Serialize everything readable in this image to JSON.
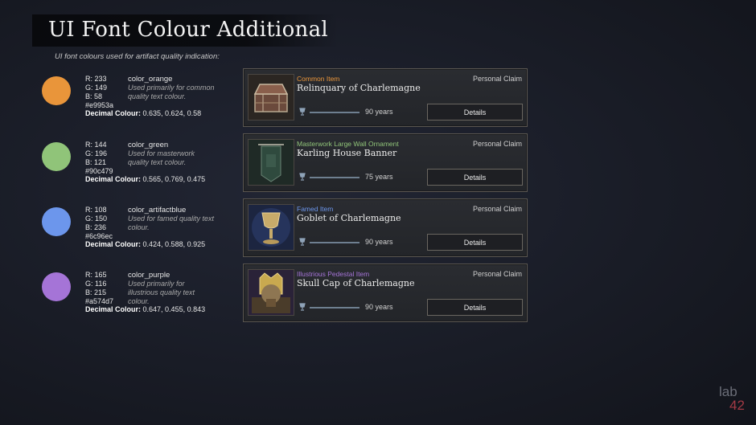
{
  "header": {
    "title": "UI Font Colour Additional",
    "subtitle": "UI font colours used for artifact quality indication:"
  },
  "colors": [
    {
      "hex_color": "#e9953a",
      "r": "R: 233",
      "g": "G: 149",
      "b": "B: 58",
      "hex": "#e9953a",
      "name": "color_orange",
      "desc": "Used primarily for common quality text colour.",
      "decimal_label": "Decimal Colour:",
      "decimal": "0.635, 0.624, 0.58"
    },
    {
      "hex_color": "#90c479",
      "r": "R: 144",
      "g": "G: 196",
      "b": "B: 121",
      "hex": "#90c479",
      "name": "color_green",
      "desc": "Used for masterwork quality text colour.",
      "decimal_label": "Decimal Colour:",
      "decimal": "0.565, 0.769, 0.475"
    },
    {
      "hex_color": "#6c96ec",
      "r": "R: 108",
      "g": "G: 150",
      "b": "B: 236",
      "hex": "#6c96ec",
      "name": "color_artifactblue",
      "desc": "Used for famed quality text colour.",
      "decimal_label": "Decimal Colour:",
      "decimal": "0.424, 0.588, 0.925"
    },
    {
      "hex_color": "#a574d7",
      "r": "R: 165",
      "g": "G: 116",
      "b": "B: 215",
      "hex": "#a574d7",
      "name": "color_purple",
      "desc": "Used primarily for illustrious quality text colour.",
      "decimal_label": "Decimal Colour:",
      "decimal": "0.647, 0.455, 0.843"
    }
  ],
  "items": [
    {
      "quality": "Common Item",
      "quality_color": "#e9953a",
      "name": "Relinquary of Charlemagne",
      "claim": "Personal Claim",
      "years": "90 years",
      "details": "Details",
      "icon": "reliquary-chest-icon"
    },
    {
      "quality": "Masterwork Large Wall Ornament",
      "quality_color": "#90c479",
      "name": "Karling House Banner",
      "claim": "Personal Claim",
      "years": "75 years",
      "details": "Details",
      "icon": "banner-icon"
    },
    {
      "quality": "Famed Item",
      "quality_color": "#6c96ec",
      "name": "Goblet of Charlemagne",
      "claim": "Personal Claim",
      "years": "90 years",
      "details": "Details",
      "icon": "goblet-icon"
    },
    {
      "quality": "Illustrious Pedestal Item",
      "quality_color": "#a574d7",
      "name": "Skull Cap of Charlemagne",
      "claim": "Personal Claim",
      "years": "90 years",
      "details": "Details",
      "icon": "skull-cap-icon"
    }
  ],
  "logo": {
    "line1": "lab",
    "line2": "42"
  }
}
